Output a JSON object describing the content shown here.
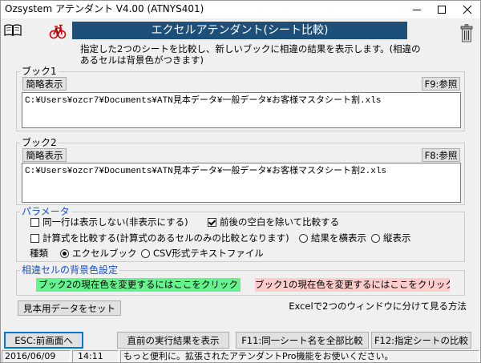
{
  "window": {
    "title": "Ozsystem アテンダント V4.00 (ATNYS401)",
    "controls": [
      "minimize-icon",
      "maximize-icon",
      "close-icon"
    ]
  },
  "header": {
    "title": "エクセルアテンダント(シート比較)",
    "left_icons": [
      "book-icon",
      "bicycle-icon"
    ],
    "right_icon": "trash-icon"
  },
  "description": [
    "指定した2つのシートを比較し、新しいブックに相違の結果を表示します。(相違の",
    "あるセルは背景色がつきます)"
  ],
  "book1": {
    "legend": "ブック1",
    "summary_button": "簡略表示",
    "browse_button": "F9:参照",
    "path": "C:¥Users¥ozcr7¥Documents¥ATN見本データ¥一般データ¥お客様マスタシート割.xls"
  },
  "book2": {
    "legend": "ブック2",
    "summary_button": "簡略表示",
    "browse_button": "F8:参照",
    "path": "C:¥Users¥ozcr7¥Documents¥ATN見本データ¥一般データ¥お客様マスタシート割2.xls"
  },
  "params": {
    "legend": "パラメータ",
    "hide_same_rows": {
      "label": "同一行は表示しない(非表示にする)",
      "checked": false
    },
    "trim_spaces": {
      "label": "前後の空白を除いて比較する",
      "checked": true
    },
    "compare_formulas": {
      "label": "計算式を比較する(計算式のあるセルのみの比較となります)",
      "checked": false
    },
    "result_layout": {
      "options": [
        {
          "label": "結果を横表示",
          "selected": false
        },
        {
          "label": "縦表示",
          "selected": false
        }
      ]
    },
    "output_type": {
      "label": "種類",
      "options": [
        {
          "label": "エクセルブック",
          "selected": true
        },
        {
          "label": "CSV形式テキストファイル",
          "selected": false
        }
      ]
    }
  },
  "diff_colors": {
    "legend": "相違セルの背景色設定",
    "book2_button": {
      "label": "ブック2の現在色を変更するにはここをクリック",
      "color": "#66f28d"
    },
    "book1_button": {
      "label": "ブック1の現在色を変更するにはここをクリック",
      "color": "#ffcccc"
    }
  },
  "sample_button": "見本用データをセット",
  "excel_tip": "Excelで2つのウィンドウに分けて見る方法",
  "footer_buttons": {
    "back": "ESC:前画面へ",
    "last_result": "直前の実行結果を表示",
    "compare_all": "F11:同一シート名を全部比較",
    "compare_selected": "F12:指定シートの比較"
  },
  "status_bar": {
    "date": "2016/06/09",
    "time": "14:11",
    "message": "もっと便利に。拡張されたアテンダントPro機能をお使いください。"
  },
  "theme": {
    "header_bg": "#1d4f7b",
    "header_fg": "#ffffff",
    "legend_accent": "#1a4fd1",
    "focus_border": "#0078d7",
    "bicycle_color": "#d40000"
  }
}
